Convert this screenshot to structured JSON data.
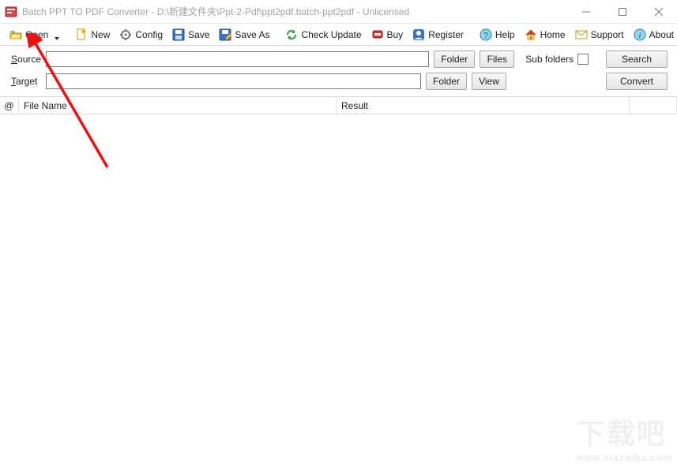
{
  "window": {
    "title": "Batch PPT TO PDF Converter - D:\\新建文件夹\\Ppt-2-Pdf\\ppt2pdf.batch-ppt2pdf - Unlicensed"
  },
  "toolbar": {
    "open": "Open",
    "new": "New",
    "config": "Config",
    "save": "Save",
    "save_as": "Save As",
    "check_update": "Check Update",
    "buy": "Buy",
    "register": "Register",
    "help": "Help",
    "home": "Home",
    "support": "Support",
    "about": "About"
  },
  "form": {
    "source_label": "Source",
    "source_value": "",
    "target_label": "Target",
    "target_value": "",
    "folder_btn": "Folder",
    "files_btn": "Files",
    "view_btn": "View",
    "subfolders_label": "Sub folders",
    "subfolders_checked": false,
    "search_btn": "Search",
    "convert_btn": "Convert"
  },
  "table": {
    "col_at": "@",
    "col_file": "File Name",
    "col_result": "Result"
  },
  "watermark": {
    "big": "下载吧",
    "small": "www.xiazaiba.com"
  }
}
